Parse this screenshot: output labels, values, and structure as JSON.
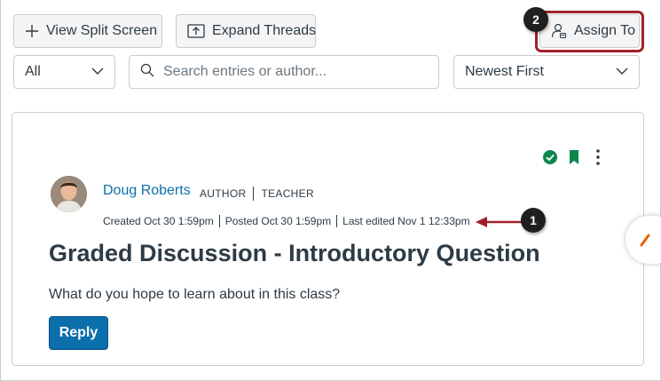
{
  "toolbar": {
    "split_screen_label": "View Split Screen",
    "expand_threads_label": "Expand Threads",
    "assign_to_label": "Assign To"
  },
  "filters": {
    "filter_value": "All",
    "search_placeholder": "Search entries or author...",
    "sort_value": "Newest First"
  },
  "callouts": {
    "one": "1",
    "two": "2"
  },
  "post": {
    "author": "Doug Roberts",
    "role_author": "AUTHOR",
    "role_teacher": "TEACHER",
    "created": "Created Oct 30 1:59pm",
    "posted": "Posted Oct 30 1:59pm",
    "edited": "Last edited Nov 1 12:33pm",
    "title": "Graded Discussion - Introductory Question",
    "body": "What do you hope to learn about in this class?",
    "reply_label": "Reply"
  },
  "colors": {
    "accent": "#0b6fab",
    "highlight": "#a1212b",
    "published": "#0b874b",
    "callout_arrow": "#a1212b"
  },
  "icons": {
    "split_screen": "plus-icon",
    "expand_threads": "expand-icon",
    "assign_to": "assign-user-icon",
    "search": "search-icon",
    "dropdown": "chevron-down-icon",
    "published": "check-circle-icon",
    "bookmark": "bookmark-icon",
    "menu": "more-vertical-icon"
  }
}
